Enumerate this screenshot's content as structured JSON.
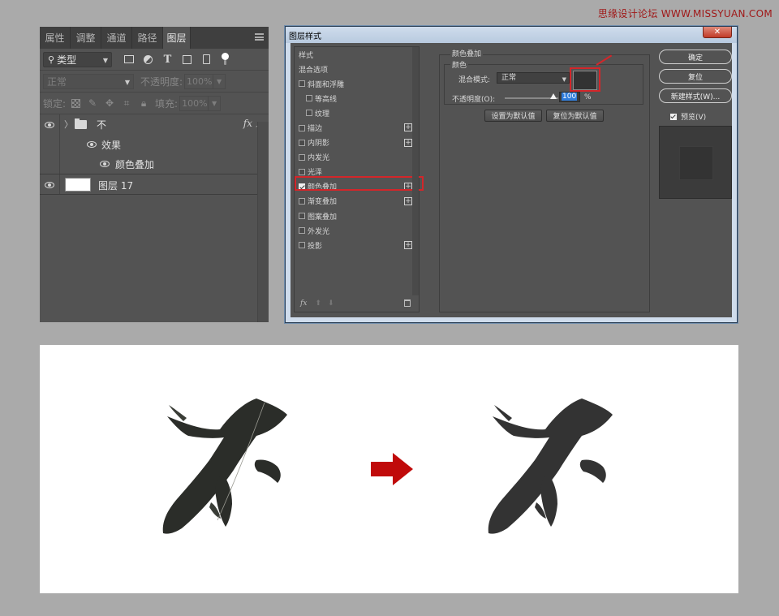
{
  "watermark": "思缘设计论坛 WWW.MISSYUAN.COM",
  "layers_panel": {
    "tabs": [
      "属性",
      "调整",
      "通道",
      "路径",
      "图层"
    ],
    "active_tab": "图层",
    "filter_label": "类型",
    "blend_mode": "正常",
    "opacity_label": "不透明度:",
    "opacity_value": "100%",
    "lock_label": "锁定:",
    "fill_label": "填充:",
    "fill_value": "100%",
    "layers": [
      {
        "name": "不",
        "type": "group",
        "fx": "fx"
      },
      {
        "name": "效果",
        "type": "effects"
      },
      {
        "name": "颜色叠加",
        "type": "effect"
      },
      {
        "name": "图层 17",
        "type": "layer"
      }
    ]
  },
  "dialog": {
    "title": "图层样式",
    "close_label": "✕",
    "style_list": [
      {
        "label": "样式",
        "checkbox": false,
        "plus": false,
        "checked": false,
        "indent": false
      },
      {
        "label": "混合选项",
        "checkbox": false,
        "plus": false,
        "checked": false,
        "indent": false
      },
      {
        "label": "斜面和浮雕",
        "checkbox": true,
        "plus": false,
        "checked": false,
        "indent": false
      },
      {
        "label": "等高线",
        "checkbox": true,
        "plus": false,
        "checked": false,
        "indent": true
      },
      {
        "label": "纹理",
        "checkbox": true,
        "plus": false,
        "checked": false,
        "indent": true
      },
      {
        "label": "描边",
        "checkbox": true,
        "plus": true,
        "checked": false,
        "indent": false
      },
      {
        "label": "内阴影",
        "checkbox": true,
        "plus": true,
        "checked": false,
        "indent": false
      },
      {
        "label": "内发光",
        "checkbox": true,
        "plus": false,
        "checked": false,
        "indent": false
      },
      {
        "label": "光泽",
        "checkbox": true,
        "plus": false,
        "checked": false,
        "indent": false
      },
      {
        "label": "颜色叠加",
        "checkbox": true,
        "plus": true,
        "checked": true,
        "indent": false
      },
      {
        "label": "渐变叠加",
        "checkbox": true,
        "plus": true,
        "checked": false,
        "indent": false
      },
      {
        "label": "图案叠加",
        "checkbox": true,
        "plus": false,
        "checked": false,
        "indent": false
      },
      {
        "label": "外发光",
        "checkbox": true,
        "plus": false,
        "checked": false,
        "indent": false
      },
      {
        "label": "投影",
        "checkbox": true,
        "plus": true,
        "checked": false,
        "indent": false
      }
    ],
    "footer_fx": "fx",
    "section_title": "颜色叠加",
    "group_title": "颜色",
    "blend_mode_label": "混合模式:",
    "blend_mode_value": "正常",
    "overlay_color": "#333333",
    "opacity_label": "不透明度(O):",
    "opacity_value": "100",
    "opacity_unit": "%",
    "btn_set_default": "设置为默认值",
    "btn_reset_default": "复位为默认值",
    "btn_ok": "确定",
    "btn_reset": "复位",
    "btn_new_style": "新建样式(W)...",
    "preview_label": "预览(V)"
  },
  "comparison": {
    "character": "不",
    "arrow_color": "#c00a0a",
    "after_color": "#333333"
  }
}
